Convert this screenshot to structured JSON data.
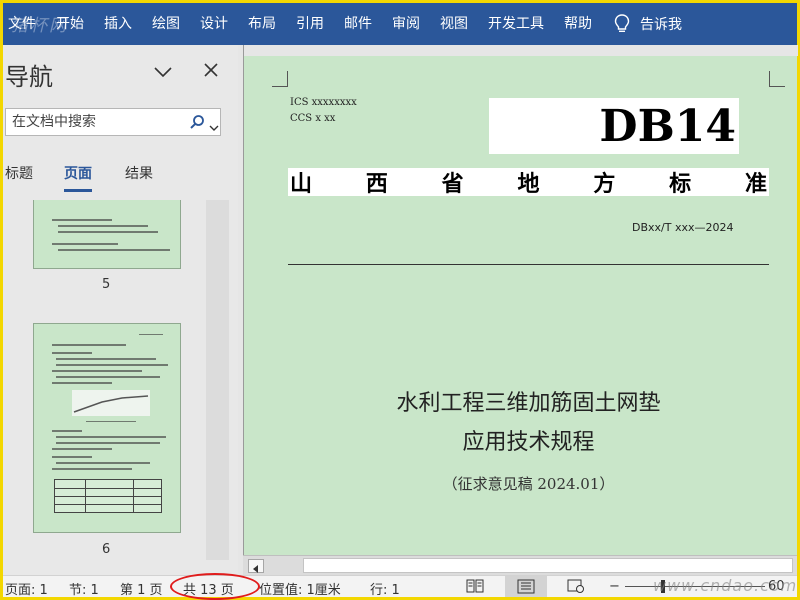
{
  "ribbon": {
    "tabs": [
      "文件",
      "开始",
      "插入",
      "绘图",
      "设计",
      "布局",
      "引用",
      "邮件",
      "审阅",
      "视图",
      "开发工具",
      "帮助"
    ],
    "tell_me": "告诉我",
    "watermark": "猪杯网"
  },
  "nav_pane": {
    "title": "导航",
    "search_placeholder": "在文档中搜索",
    "tabs": [
      "标题",
      "页面",
      "结果"
    ],
    "active_tab": "页面",
    "thumbnails": [
      {
        "page": "5"
      },
      {
        "page": "6"
      }
    ]
  },
  "document": {
    "ics": "ICS xxxxxxxx",
    "ccs": "CCS x xx",
    "db_code": "DB14",
    "standard_type_chars": [
      "山",
      "西",
      "省",
      "地",
      "方",
      "标",
      "准"
    ],
    "doc_number": "DBxx/T xxx—2024",
    "title_lines": [
      "水利工程三维加筋固土网垫",
      "应用技术规程"
    ],
    "subtitle": "（征求意见稿 2024.01）"
  },
  "status_bar": {
    "page": "页面: 1",
    "section": "节: 1",
    "page_of": "第 1 页",
    "page_count": "共 13 页",
    "position": "位置值: 1厘米",
    "line": "行: 1",
    "zoom": "60",
    "watermark": "www.cndao.com"
  },
  "colors": {
    "ribbon": "#2b579a",
    "page_bg": "#c9e6c9",
    "highlight_ring": "#e01c1c",
    "frame": "#f3d700"
  }
}
